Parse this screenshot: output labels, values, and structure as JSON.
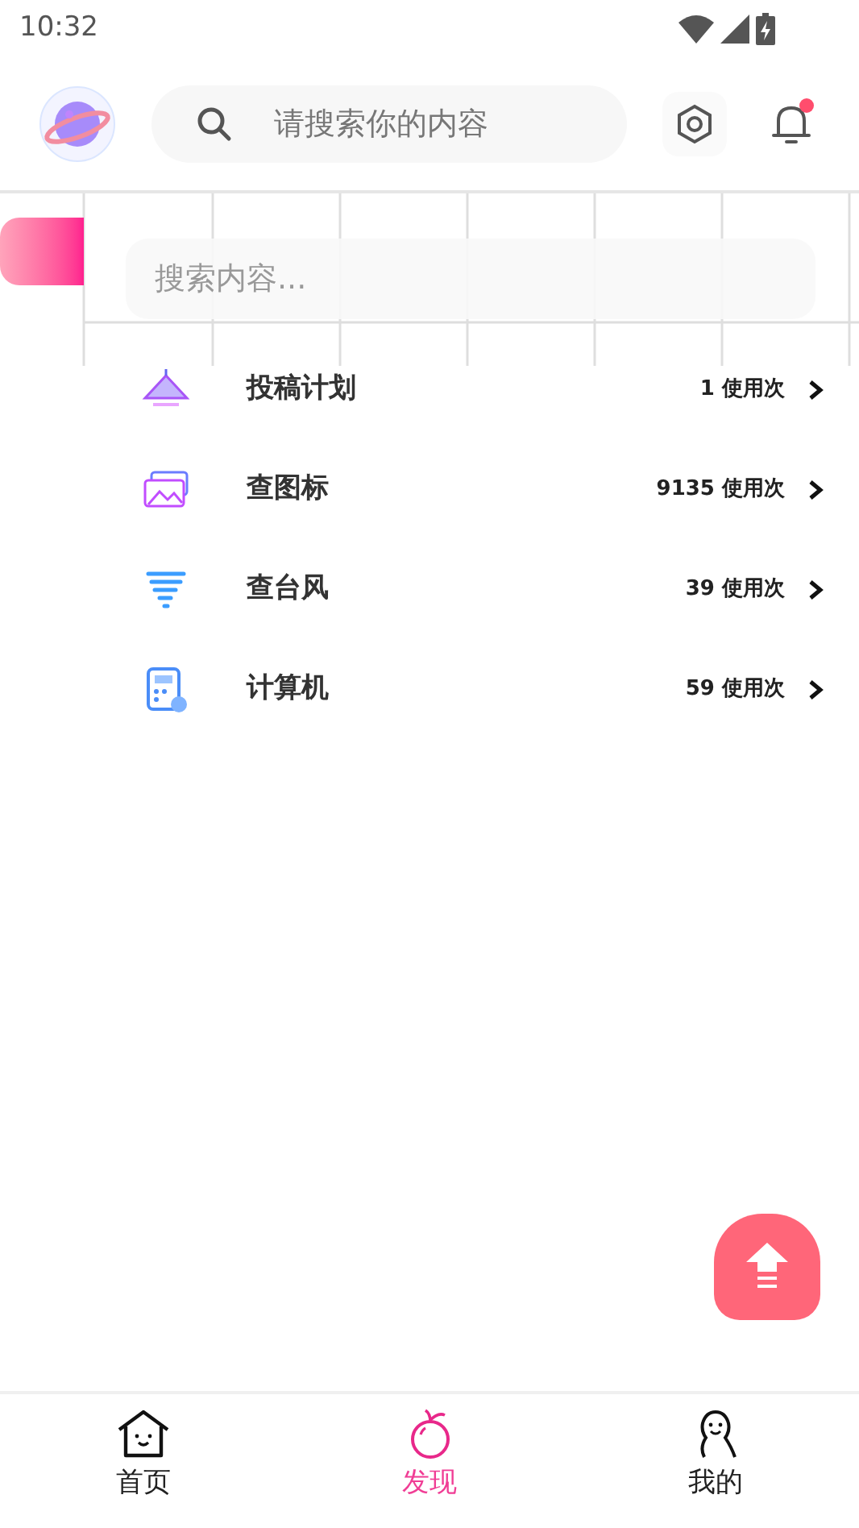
{
  "status_bar": {
    "time": "10:32"
  },
  "header": {
    "search": {
      "placeholder": "请搜索你的内容"
    },
    "notification_dot": true
  },
  "content_search": {
    "placeholder": "搜索内容..."
  },
  "tools": [
    {
      "kind": "tent",
      "name": "投稿计划",
      "usage": "1 使用次"
    },
    {
      "kind": "image",
      "name": "查图标",
      "usage": "9135 使用次"
    },
    {
      "kind": "tornado",
      "name": "查台风",
      "usage": "39 使用次"
    },
    {
      "kind": "calculator",
      "name": "计算机",
      "usage": "59 使用次"
    }
  ],
  "bottom_nav": [
    {
      "kind": "home",
      "label": "首页",
      "selected": false
    },
    {
      "kind": "discover",
      "label": "发现",
      "selected": true
    },
    {
      "kind": "profile",
      "label": "我的",
      "selected": false
    }
  ]
}
